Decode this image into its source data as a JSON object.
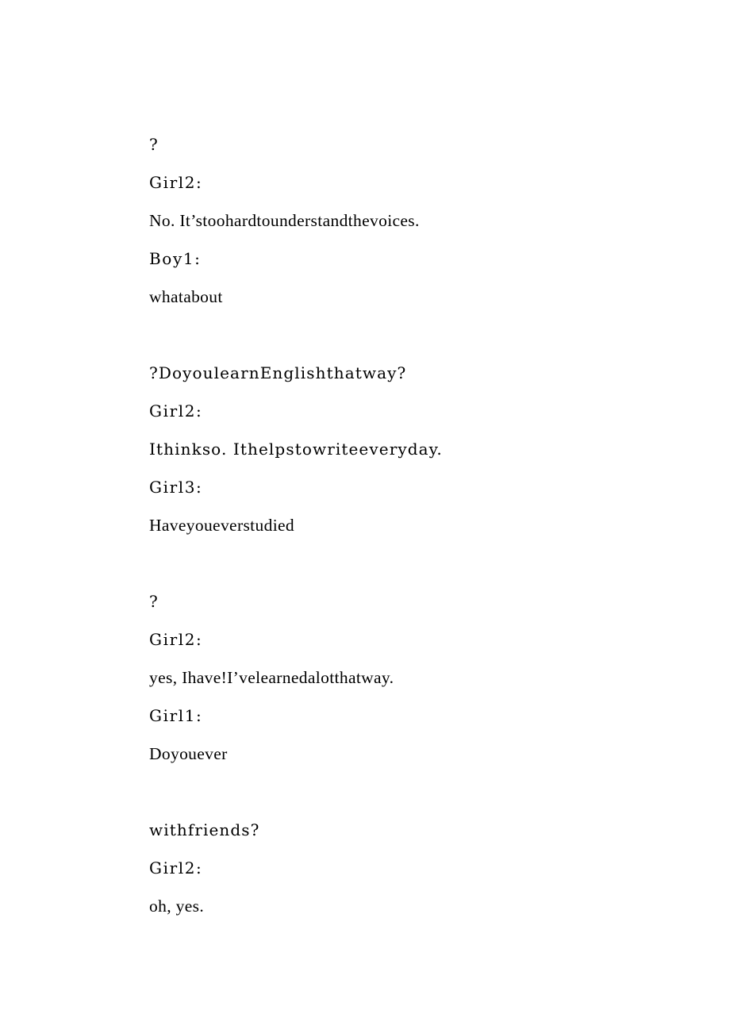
{
  "document": {
    "page_background": "#ffffff",
    "text_color": "#000000",
    "lines": [
      {
        "id": "l1",
        "text": "?",
        "kind": "dialogue",
        "style": "mono"
      },
      {
        "id": "l2",
        "text": "Girl2:",
        "kind": "speaker",
        "style": "label"
      },
      {
        "id": "l3",
        "text": "No. It’stoohardtounderstandthevoices.",
        "kind": "dialogue",
        "style": "serif"
      },
      {
        "id": "l4",
        "text": "Boy1:",
        "kind": "speaker",
        "style": "label"
      },
      {
        "id": "l5",
        "text": "whatabout",
        "kind": "dialogue",
        "style": "serif"
      },
      {
        "id": "l6",
        "text": "",
        "kind": "blank",
        "style": "blank"
      },
      {
        "id": "l7",
        "text": "?DoyoulearnEnglishthatway?",
        "kind": "dialogue",
        "style": "mono"
      },
      {
        "id": "l8",
        "text": "Girl2:",
        "kind": "speaker",
        "style": "label"
      },
      {
        "id": "l9",
        "text": "Ithinkso. Ithelpstowriteeveryday.",
        "kind": "dialogue",
        "style": "mono"
      },
      {
        "id": "l10",
        "text": "Girl3:",
        "kind": "speaker",
        "style": "label"
      },
      {
        "id": "l11",
        "text": "Haveyoueverstudied",
        "kind": "dialogue",
        "style": "serif"
      },
      {
        "id": "l12",
        "text": "",
        "kind": "blank",
        "style": "blank"
      },
      {
        "id": "l13",
        "text": "?",
        "kind": "dialogue",
        "style": "mono"
      },
      {
        "id": "l14",
        "text": "Girl2:",
        "kind": "speaker",
        "style": "label"
      },
      {
        "id": "l15",
        "text": "yes, Ihave!I’velearnedalotthatway.",
        "kind": "dialogue",
        "style": "serif"
      },
      {
        "id": "l16",
        "text": "Girl1:",
        "kind": "speaker",
        "style": "label"
      },
      {
        "id": "l17",
        "text": "Doyouever",
        "kind": "dialogue",
        "style": "serif"
      },
      {
        "id": "l18",
        "text": "",
        "kind": "blank",
        "style": "blank"
      },
      {
        "id": "l19",
        "text": "withfriends?",
        "kind": "dialogue",
        "style": "mono"
      },
      {
        "id": "l20",
        "text": "Girl2:",
        "kind": "speaker",
        "style": "label"
      },
      {
        "id": "l21",
        "text": "oh, yes.",
        "kind": "dialogue",
        "style": "serif"
      }
    ]
  }
}
